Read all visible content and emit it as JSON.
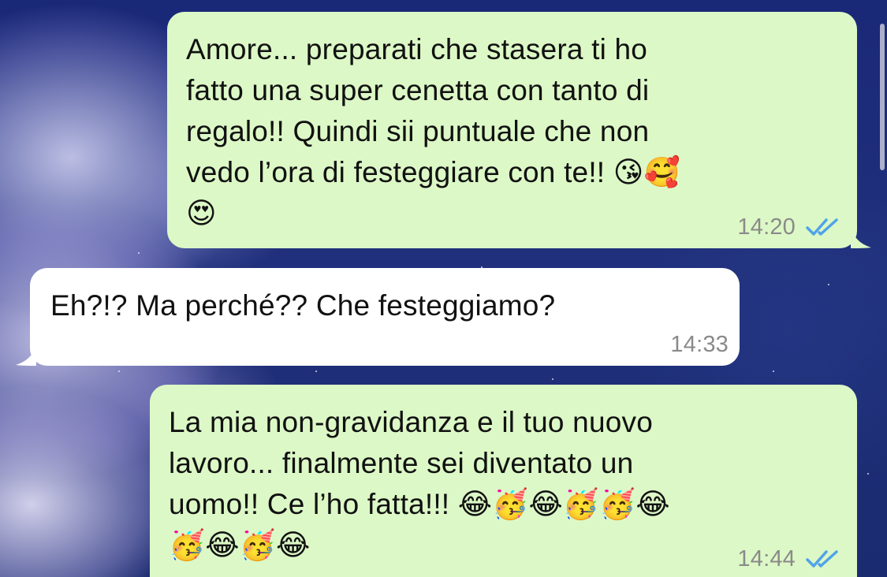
{
  "messages": [
    {
      "direction": "outgoing",
      "text": "Amore... preparati che stasera ti ho\nfatto una super cenetta con tanto di\nregalo!! Quindi sii puntuale che non\nvedo l’ora di festeggiare con te!! 😘🥰\n😍",
      "time": "14:20",
      "status": "read"
    },
    {
      "direction": "incoming",
      "text": "Eh?!? Ma perché?? Che festeggiamo?",
      "time": "14:33"
    },
    {
      "direction": "outgoing",
      "text": "La mia non-gravidanza e il tuo nuovo\nlavoro... finalmente sei diventato un\nuomo!! Ce l’ho fatta!!! 😂🥳😂🥳🥳😂\n🥳😂🥳😂",
      "time": "14:44",
      "status": "read"
    }
  ],
  "colors": {
    "outgoing_bubble": "#dcf8c6",
    "incoming_bubble": "#ffffff",
    "read_ticks": "#4fa3e8",
    "timestamp": "#8a8a8a"
  },
  "icons": {
    "read_receipt": "double-check-icon"
  }
}
